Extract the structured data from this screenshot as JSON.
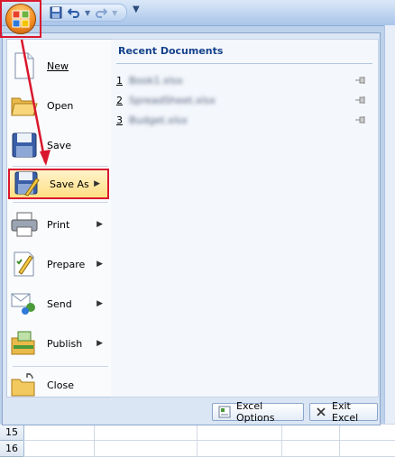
{
  "menu": {
    "items": [
      {
        "label": "New",
        "accel": "N"
      },
      {
        "label": "Open",
        "accel": "O"
      },
      {
        "label": "Save",
        "accel": "S"
      },
      {
        "label": "Save As",
        "accel": "A"
      },
      {
        "label": "Print",
        "accel": "P"
      },
      {
        "label": "Prepare",
        "accel": "e"
      },
      {
        "label": "Send",
        "accel": "d"
      },
      {
        "label": "Publish",
        "accel": "u"
      },
      {
        "label": "Close",
        "accel": "C"
      }
    ]
  },
  "recent": {
    "title": "Recent Documents",
    "docs": [
      {
        "num": "1",
        "name": "Book1.xlsx"
      },
      {
        "num": "2",
        "name": "SpreadSheet.xlsx"
      },
      {
        "num": "3",
        "name": "Budget.xlsx"
      }
    ]
  },
  "footer": {
    "options_label": "Excel Options",
    "exit_label": "Exit Excel"
  },
  "grid": {
    "rows": [
      "15",
      "16"
    ]
  },
  "colors": {
    "highlight_border": "#d9182d",
    "accent": "#15428b"
  }
}
